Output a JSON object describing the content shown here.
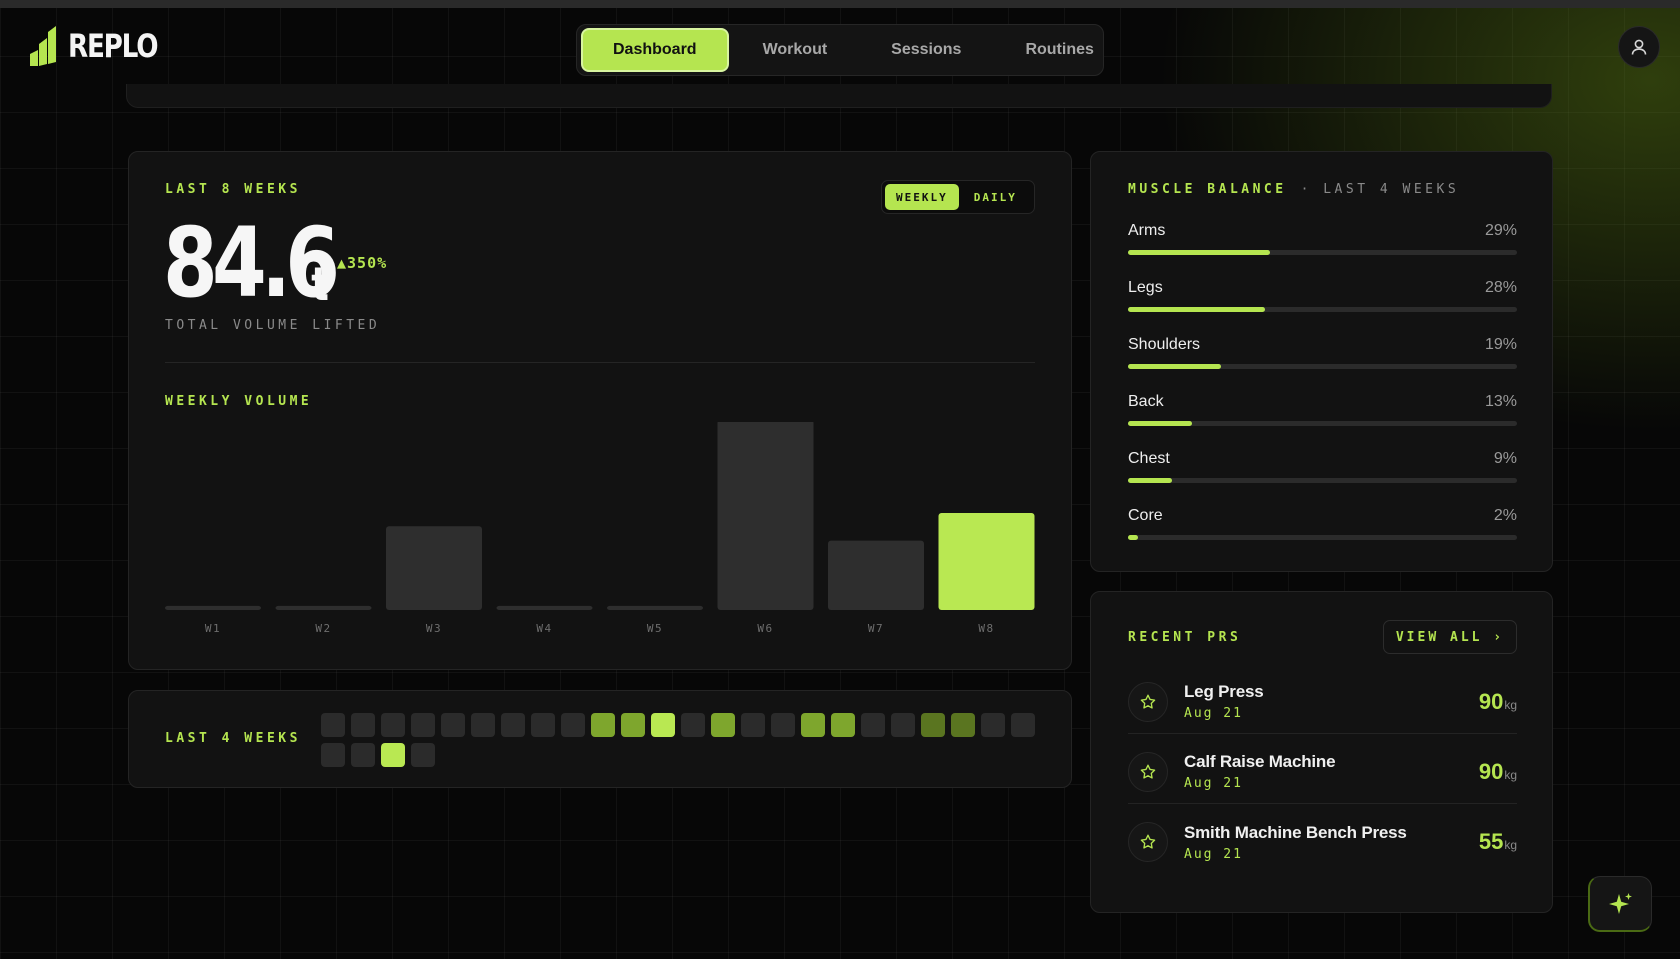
{
  "app": {
    "name": "REPLO"
  },
  "nav": {
    "tabs": [
      {
        "label": "Dashboard",
        "active": true
      },
      {
        "label": "Workout"
      },
      {
        "label": "Sessions"
      },
      {
        "label": "Routines"
      }
    ]
  },
  "colors": {
    "accent": "#b5e550",
    "background": "#070707",
    "card": "#121212",
    "bar_inactive": "#2e2e2e"
  },
  "icons": {
    "avatar": "user-icon",
    "pr": "star-icon",
    "assistant": "sparkle-icon",
    "view_all": "chevron-right-icon"
  },
  "volume": {
    "period_label": "LAST 8 WEEKS",
    "toggle": {
      "weekly": "WEEKLY",
      "daily": "DAILY",
      "selected": "weekly"
    },
    "value": "84.6",
    "unit": "t",
    "delta": "▲350%",
    "caption": "TOTAL VOLUME LIFTED",
    "chart_title": "WEEKLY VOLUME"
  },
  "chart_data": {
    "type": "bar",
    "title": "WEEKLY VOLUME",
    "categories": [
      "W1",
      "W2",
      "W3",
      "W4",
      "W5",
      "W6",
      "W7",
      "W8"
    ],
    "values": [
      0.4,
      0.4,
      8.2,
      0.4,
      0.4,
      18.6,
      6.8,
      9.5
    ],
    "ylim": [
      0,
      19
    ],
    "highlight_index": 7,
    "xlabel": "",
    "ylabel": "",
    "grid": false
  },
  "activity": {
    "label": "LAST 4 WEEKS",
    "levels": [
      0,
      0,
      0,
      0,
      0,
      0,
      0,
      0,
      0,
      2,
      2,
      3,
      0,
      2,
      0,
      0,
      2,
      2,
      0,
      0,
      1,
      1,
      0,
      0,
      0,
      0,
      3,
      0
    ]
  },
  "muscle": {
    "title": "MUSCLE BALANCE",
    "subtitle": "· LAST 4 WEEKS",
    "items": [
      {
        "name": "Arms",
        "pct": "29%",
        "value": 0.29
      },
      {
        "name": "Legs",
        "pct": "28%",
        "value": 0.28
      },
      {
        "name": "Shoulders",
        "pct": "19%",
        "value": 0.19
      },
      {
        "name": "Back",
        "pct": "13%",
        "value": 0.13
      },
      {
        "name": "Chest",
        "pct": "9%",
        "value": 0.09
      },
      {
        "name": "Core",
        "pct": "2%",
        "value": 0.02
      }
    ]
  },
  "prs": {
    "title": "RECENT PRS",
    "view_all": "VIEW ALL ›",
    "items": [
      {
        "name": "Leg Press",
        "date": "Aug 21",
        "value": "90",
        "unit": "kg"
      },
      {
        "name": "Calf Raise Machine",
        "date": "Aug 21",
        "value": "90",
        "unit": "kg"
      },
      {
        "name": "Smith Machine Bench Press",
        "date": "Aug 21",
        "value": "55",
        "unit": "kg"
      }
    ]
  }
}
